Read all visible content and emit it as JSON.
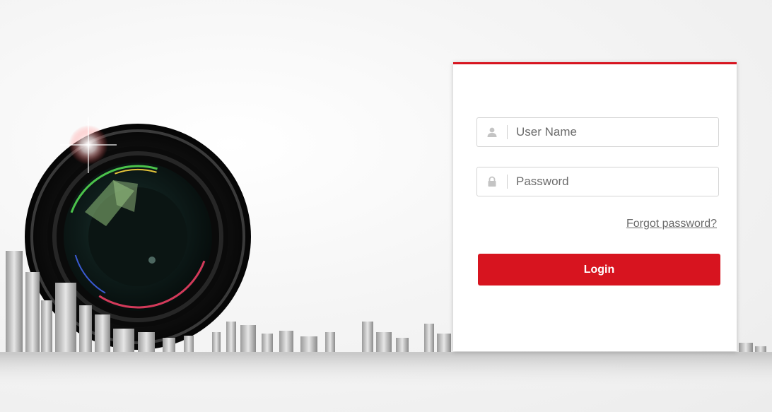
{
  "login": {
    "username_placeholder": "User Name",
    "password_placeholder": "Password",
    "forgot_label": "Forgot password?",
    "login_label": "Login"
  },
  "icons": {
    "user": "user-icon",
    "lock": "lock-icon",
    "hero": "camera-lens-icon"
  },
  "colors": {
    "accent": "#d7141f",
    "field_border": "#d4d4d4",
    "placeholder": "#6b6b6b"
  }
}
